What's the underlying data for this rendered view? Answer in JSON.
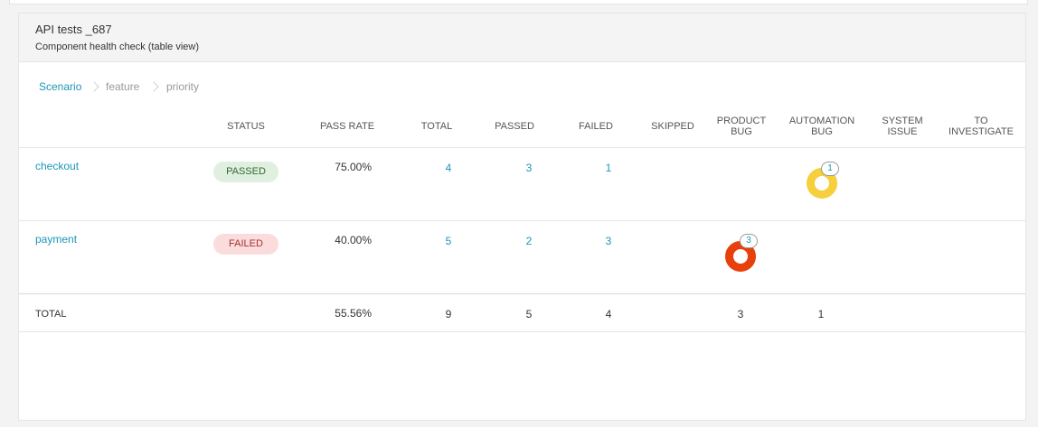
{
  "widget": {
    "title": "API tests _687",
    "subtitle": "Component health check (table view)"
  },
  "breadcrumb": {
    "items": [
      "Scenario",
      "feature",
      "priority"
    ]
  },
  "columns": {
    "status": "STATUS",
    "pass_rate": "PASS RATE",
    "total": "TOTAL",
    "passed": "PASSED",
    "failed": "FAILED",
    "skipped": "SKIPPED",
    "product_bug": [
      "PRODUCT",
      "BUG"
    ],
    "automation_bug": [
      "AUTOMATION",
      "BUG"
    ],
    "system_issue": [
      "SYSTEM",
      "ISSUE"
    ],
    "to_investigate": [
      "TO",
      "INVESTIGATE"
    ]
  },
  "rows": [
    {
      "name": "checkout",
      "status": "PASSED",
      "pass_rate": "75.00%",
      "total": "4",
      "passed": "3",
      "failed": "1",
      "automation_bug": "1"
    },
    {
      "name": "payment",
      "status": "FAILED",
      "pass_rate": "40.00%",
      "total": "5",
      "passed": "2",
      "failed": "3",
      "product_bug": "3"
    }
  ],
  "totals": {
    "label": "TOTAL",
    "pass_rate": "55.56%",
    "total": "9",
    "passed": "5",
    "failed": "4",
    "product_bug": "3",
    "automation_bug": "1"
  },
  "colors": {
    "accent": "#1c96b8",
    "product_bug": "#e8400c",
    "automation_bug": "#f5cf3c",
    "passed_badge": "#e0efe0",
    "failed_badge": "#fbdcdc"
  }
}
